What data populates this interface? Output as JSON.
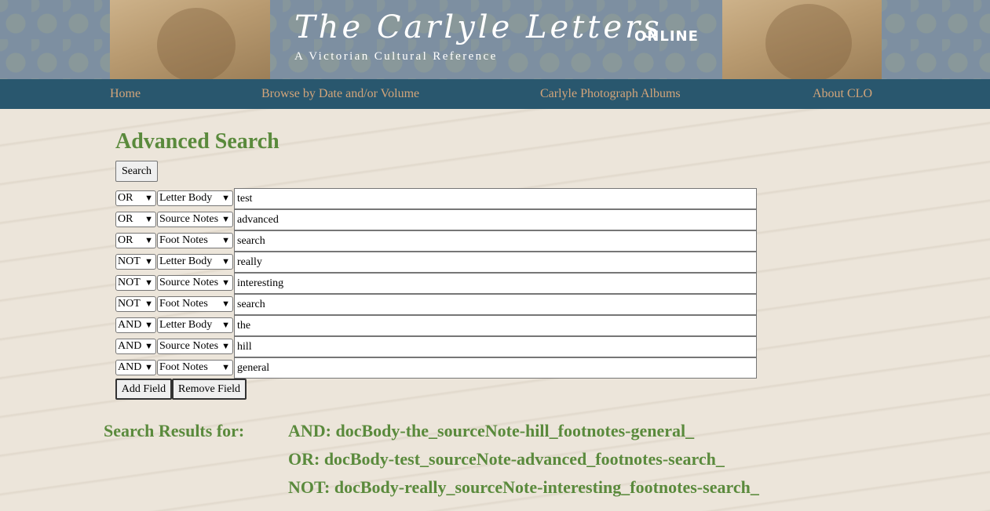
{
  "banner": {
    "title": "The Carlyle Letters",
    "online": "ONLINE",
    "subtitle": "A Victorian Cultural Reference"
  },
  "nav": {
    "home": "Home",
    "browse": "Browse by Date and/or Volume",
    "albums": "Carlyle Photograph Albums",
    "about": "About CLO"
  },
  "page": {
    "heading": "Advanced Search",
    "search_label": "Search",
    "add_field_label": "Add Field",
    "remove_field_label": "Remove Field"
  },
  "rows": [
    {
      "op": "OR",
      "field": "Letter Body",
      "term": "test"
    },
    {
      "op": "OR",
      "field": "Source Notes",
      "term": "advanced"
    },
    {
      "op": "OR",
      "field": "Foot Notes",
      "term": "search"
    },
    {
      "op": "NOT",
      "field": "Letter Body",
      "term": "really"
    },
    {
      "op": "NOT",
      "field": "Source Notes",
      "term": "interesting"
    },
    {
      "op": "NOT",
      "field": "Foot Notes",
      "term": "search"
    },
    {
      "op": "AND",
      "field": "Letter Body",
      "term": "the"
    },
    {
      "op": "AND",
      "field": "Source Notes",
      "term": "hill"
    },
    {
      "op": "AND",
      "field": "Foot Notes",
      "term": "general"
    }
  ],
  "results": {
    "label": "Search Results for:",
    "and_line": "AND: docBody-the_sourceNote-hill_footnotes-general_",
    "or_line": "OR: docBody-test_sourceNote-advanced_footnotes-search_",
    "not_line": "NOT: docBody-really_sourceNote-interesting_footnotes-search_"
  },
  "colors": {
    "accent_green": "#5a8a3c",
    "nav_bg": "#29576e",
    "nav_link": "#d3a57a",
    "banner_bg": "#7d8fa1"
  },
  "icons": {
    "dropdown": "chevron-down-icon"
  }
}
